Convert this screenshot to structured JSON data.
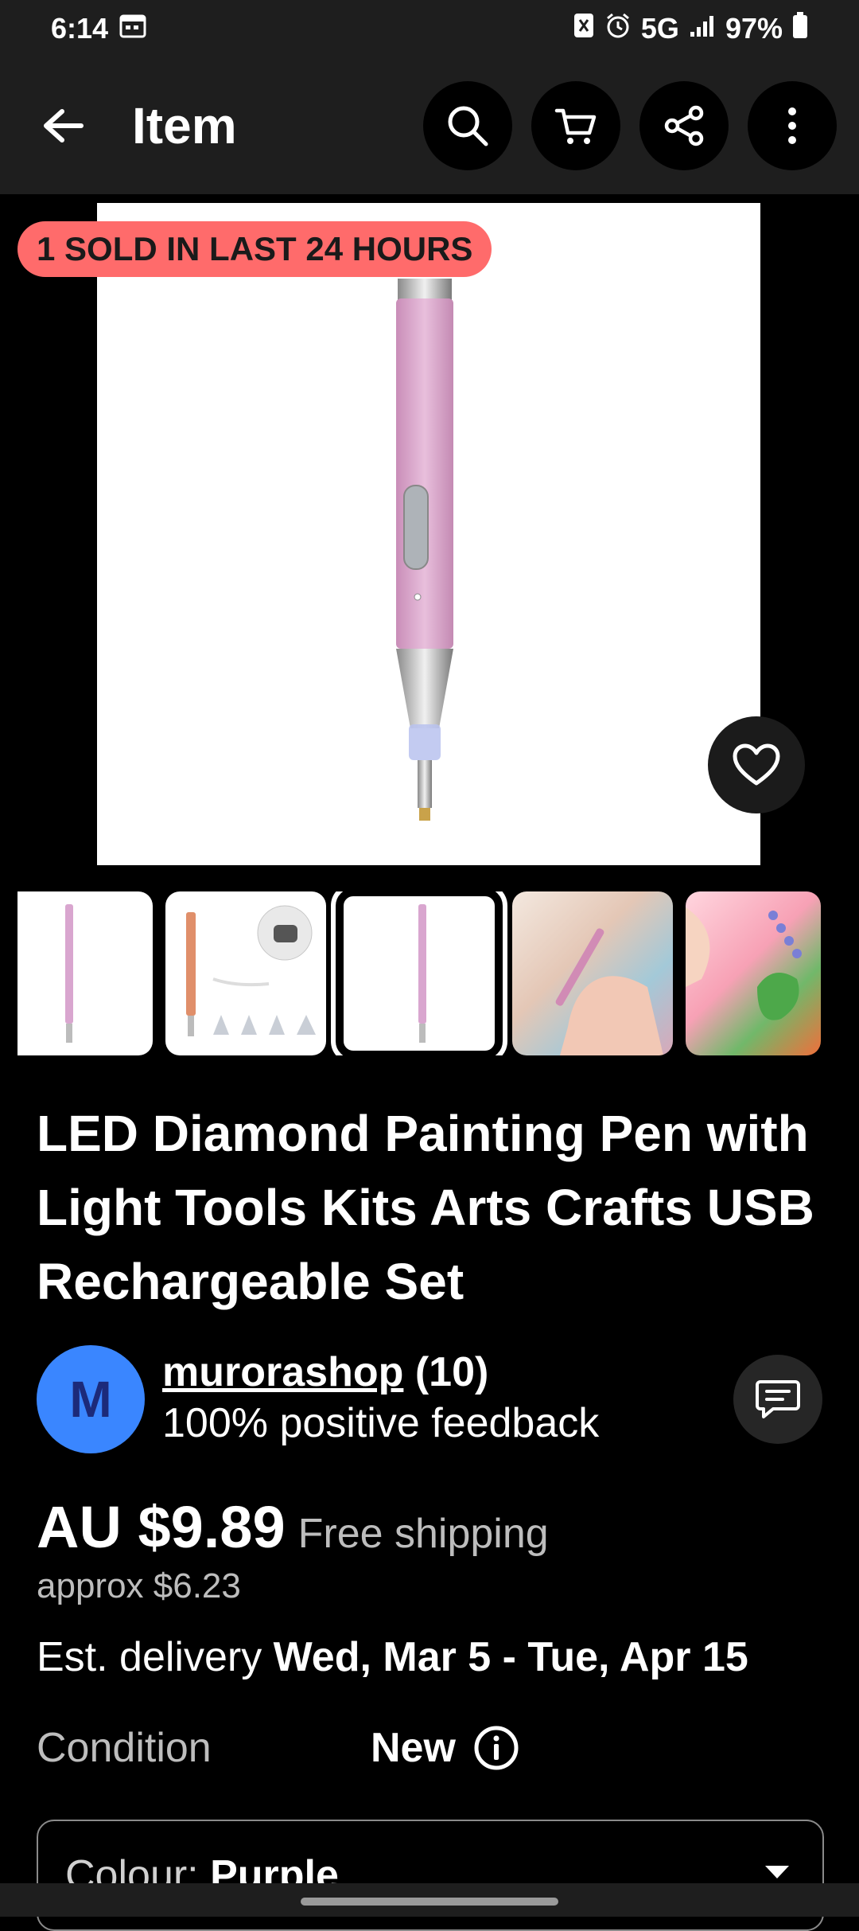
{
  "status_bar": {
    "time": "6:14",
    "network": "5G",
    "battery": "97%"
  },
  "app_bar": {
    "title": "Item"
  },
  "hero": {
    "badge": "1 SOLD IN LAST 24 HOURS"
  },
  "product": {
    "title": "LED Diamond Painting Pen with Light Tools Kits Arts Crafts USB Rechargeable Set"
  },
  "seller": {
    "avatar_letter": "M",
    "name": "murorashop",
    "count": "(10)",
    "feedback": "100% positive feedback"
  },
  "pricing": {
    "price": "AU $9.89",
    "shipping": "Free shipping",
    "approx": "approx $6.23"
  },
  "delivery": {
    "label": "Est. delivery ",
    "range": "Wed, Mar 5 - Tue, Apr 15"
  },
  "condition": {
    "label": "Condition",
    "value": "New"
  },
  "variant_select": {
    "label": "Colour: ",
    "value": "Purple"
  },
  "colors": {
    "badge_bg": "#ff6b6b",
    "avatar_bg": "#3a86ff",
    "pen_pink": "#d9a6cf"
  }
}
